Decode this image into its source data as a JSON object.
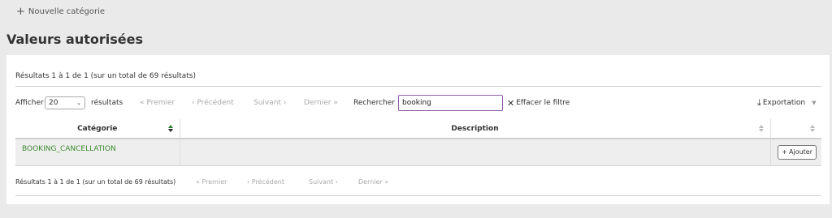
{
  "toolbar": {
    "new_category_label": "Nouvelle catégorie"
  },
  "page_title": "Valeurs autorisées",
  "info_top": "Résultats 1 à 1 de 1 (sur un total de 69 résultats)",
  "length": {
    "label_before": "Afficher",
    "value": "20",
    "label_after": "résultats"
  },
  "pagination": {
    "first": "Premier",
    "previous": "Précédent",
    "next": "Suivant",
    "last": "Dernier"
  },
  "search": {
    "label": "Rechercher :",
    "value": "booking"
  },
  "clear_filter_label": "Effacer le filtre",
  "export_label": "Exportation",
  "table": {
    "headers": {
      "category": "Catégorie",
      "description": "Description"
    },
    "rows": [
      {
        "category": "BOOKING_CANCELLATION",
        "description": "",
        "action": "Ajouter"
      }
    ]
  },
  "info_bottom": "Résultats 1 à 1 de 1 (sur un total de 69 résultats)"
}
